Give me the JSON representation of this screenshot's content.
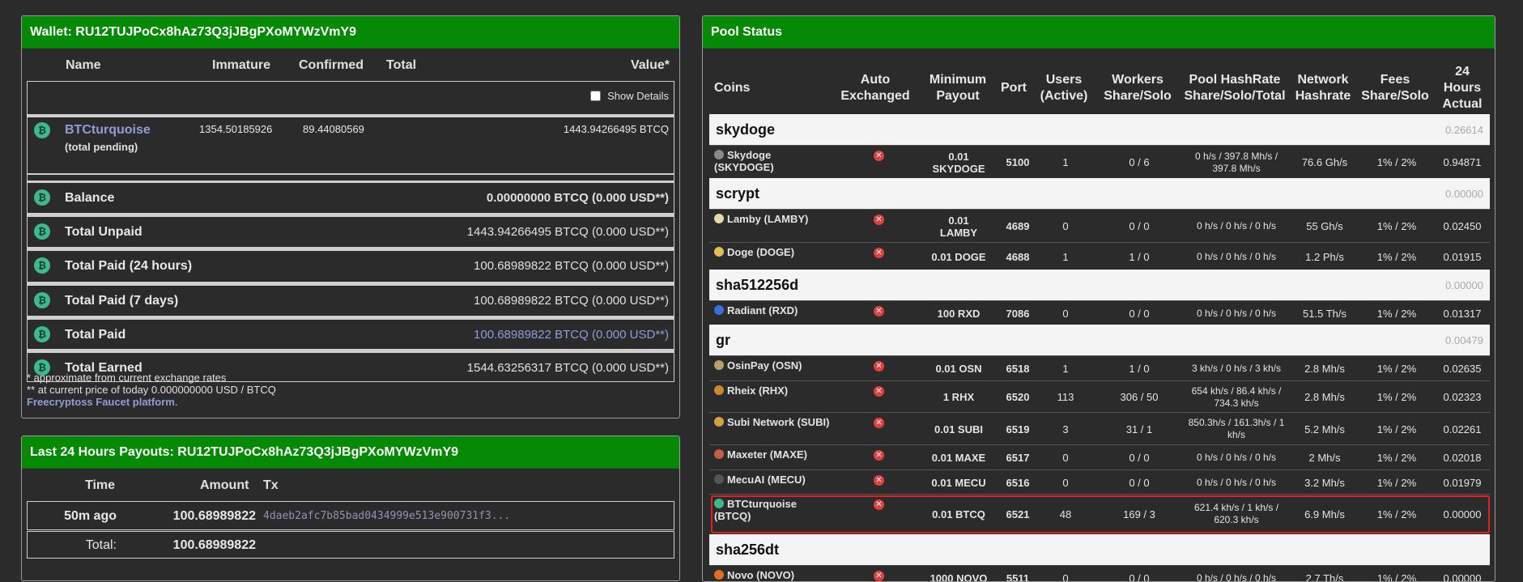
{
  "wallet": {
    "title": "Wallet: RU12TUJPoCx8hAz73Q3jJBgPXoMYWzVmY9",
    "headers": {
      "name": "Name",
      "immature": "Immature",
      "confirmed": "Confirmed",
      "total": "Total",
      "value": "Value*"
    },
    "show_details": "Show Details",
    "coin": {
      "name": "BTCturquoise",
      "pending": "(total pending)",
      "immature": "1354.50185926",
      "confirmed": "89.44080569",
      "value": "1443.94266495 BTCQ"
    },
    "rows": [
      {
        "label": "Balance",
        "value": "0.00000000 BTCQ (0.000 USD**)"
      },
      {
        "label": "Total Unpaid",
        "value": "1443.94266495 BTCQ (0.000 USD**)"
      },
      {
        "label": "Total Paid (24 hours)",
        "value": "100.68989822 BTCQ (0.000 USD**)"
      },
      {
        "label": "Total Paid (7 days)",
        "value": "100.68989822 BTCQ (0.000 USD**)"
      },
      {
        "label": "Total Paid",
        "value": "100.68989822 BTCQ (0.000 USD**)"
      },
      {
        "label": "Total Earned",
        "value": "1544.63256317 BTCQ (0.000 USD**)"
      }
    ],
    "note1": "* approximate from current exchange rates",
    "note2": "** at current price of today 0.000000000 USD / BTCQ",
    "faucet_link": "Freecryptoss Faucet platform",
    "faucet_dot": "."
  },
  "payouts": {
    "title": "Last 24 Hours Payouts: RU12TUJPoCx8hAz73Q3jJBgPXoMYWzVmY9",
    "headers": {
      "time": "Time",
      "amount": "Amount",
      "tx": "Tx"
    },
    "row": {
      "time": "50m ago",
      "amount": "100.68989822",
      "tx": "4daeb2afc7b85bad0434999e513e900731f3..."
    },
    "total_label": "Total:",
    "total_value": "100.68989822"
  },
  "pool": {
    "title": "Pool Status",
    "headers": {
      "coins": "Coins",
      "auto1": "Auto",
      "auto2": "Exchanged",
      "min1": "Minimum",
      "min2": "Payout",
      "port": "Port",
      "users1": "Users",
      "users2": "(Active)",
      "workers1": "Workers",
      "workers2": "Share/Solo",
      "hash1": "Pool HashRate",
      "hash2": "Share/Solo/Total",
      "net1": "Network",
      "net2": "Hashrate",
      "fees1": "Fees",
      "fees2": "Share/Solo",
      "h1": "24",
      "h2": "Hours",
      "h3": "Actual"
    },
    "algos": [
      {
        "name": "skydoge",
        "value": "0.26614"
      },
      {
        "name": "scrypt",
        "value": "0.00000"
      },
      {
        "name": "sha512256d",
        "value": "0.00000"
      },
      {
        "name": "gr",
        "value": "0.00479"
      },
      {
        "name": "sha256dt",
        "value": ""
      }
    ],
    "coins": [
      {
        "name": "Skydoge",
        "name2": "(SKYDOGE)",
        "min1": "0.01",
        "min2": "SKYDOGE",
        "port": "5100",
        "users": "1",
        "workers": "0 / 6",
        "hash1": "0 h/s / 397.8 Mh/s /",
        "hash2": "397.8 Mh/s",
        "net": "76.6 Gh/s",
        "fees": "1% / 2%",
        "actual": "0.94871"
      },
      {
        "name": "Lamby (LAMBY)",
        "name2": "",
        "min1": "0.01",
        "min2": "LAMBY",
        "port": "4689",
        "users": "0",
        "workers": "0 / 0",
        "hash1": "0 h/s / 0 h/s / 0 h/s",
        "hash2": "",
        "net": "55 Gh/s",
        "fees": "1% / 2%",
        "actual": "0.02450"
      },
      {
        "name": "Doge (DOGE)",
        "name2": "",
        "min1": "0.01 DOGE",
        "min2": "",
        "port": "4688",
        "users": "1",
        "workers": "1 / 0",
        "hash1": "0 h/s / 0 h/s / 0 h/s",
        "hash2": "",
        "net": "1.2 Ph/s",
        "fees": "1% / 2%",
        "actual": "0.01915"
      },
      {
        "name": "Radiant (RXD)",
        "name2": "",
        "min1": "100 RXD",
        "min2": "",
        "port": "7086",
        "users": "0",
        "workers": "0 / 0",
        "hash1": "0 h/s / 0 h/s / 0 h/s",
        "hash2": "",
        "net": "51.5 Th/s",
        "fees": "1% / 2%",
        "actual": "0.01317"
      },
      {
        "name": "OsinPay (OSN)",
        "name2": "",
        "min1": "0.01 OSN",
        "min2": "",
        "port": "6518",
        "users": "1",
        "workers": "1 / 0",
        "hash1": "3 kh/s / 0 h/s / 3 kh/s",
        "hash2": "",
        "net": "2.8 Mh/s",
        "fees": "1% / 2%",
        "actual": "0.02635"
      },
      {
        "name": "Rheix (RHX)",
        "name2": "",
        "min1": "1 RHX",
        "min2": "",
        "port": "6520",
        "users": "113",
        "workers": "306 / 50",
        "hash1": "654 kh/s / 86.4 kh/s /",
        "hash2": "734.3 kh/s",
        "net": "2.8 Mh/s",
        "fees": "1% / 2%",
        "actual": "0.02323"
      },
      {
        "name": "Subi Network (SUBI)",
        "name2": "",
        "min1": "0.01 SUBI",
        "min2": "",
        "port": "6519",
        "users": "3",
        "workers": "31 / 1",
        "hash1": "850.3h/s / 161.3h/s / 1",
        "hash2": "kh/s",
        "net": "5.2 Mh/s",
        "fees": "1% / 2%",
        "actual": "0.02261"
      },
      {
        "name": "Maxeter (MAXE)",
        "name2": "",
        "min1": "0.01 MAXE",
        "min2": "",
        "port": "6517",
        "users": "0",
        "workers": "0 / 0",
        "hash1": "0 h/s / 0 h/s / 0 h/s",
        "hash2": "",
        "net": "2 Mh/s",
        "fees": "1% / 2%",
        "actual": "0.02018"
      },
      {
        "name": "MecuAI (MECU)",
        "name2": "",
        "min1": "0.01 MECU",
        "min2": "",
        "port": "6516",
        "users": "0",
        "workers": "0 / 0",
        "hash1": "0 h/s / 0 h/s / 0 h/s",
        "hash2": "",
        "net": "3.2 Mh/s",
        "fees": "1% / 2%",
        "actual": "0.01979"
      },
      {
        "name": "BTCturquoise",
        "name2": "(BTCQ)",
        "min1": "0.01 BTCQ",
        "min2": "",
        "port": "6521",
        "users": "48",
        "workers": "169 / 3",
        "hash1": "621.4 kh/s / 1 kh/s /",
        "hash2": "620.3 kh/s",
        "net": "6.9 Mh/s",
        "fees": "1% / 2%",
        "actual": "0.00000"
      },
      {
        "name": "Novo (NOVO)",
        "name2": "",
        "min1": "1000 NOVO",
        "min2": "",
        "port": "5511",
        "users": "0",
        "workers": "0 / 0",
        "hash1": "0 h/s / 0 h/s / 0 h/s",
        "hash2": "",
        "net": "2.7 Th/s",
        "fees": "1% / 2%",
        "actual": "0.00000"
      }
    ]
  },
  "colors": {
    "header_green": "#048a04",
    "bg": "#2b2b2b",
    "link": "#8f9dd8",
    "highlight": "#e32020"
  }
}
